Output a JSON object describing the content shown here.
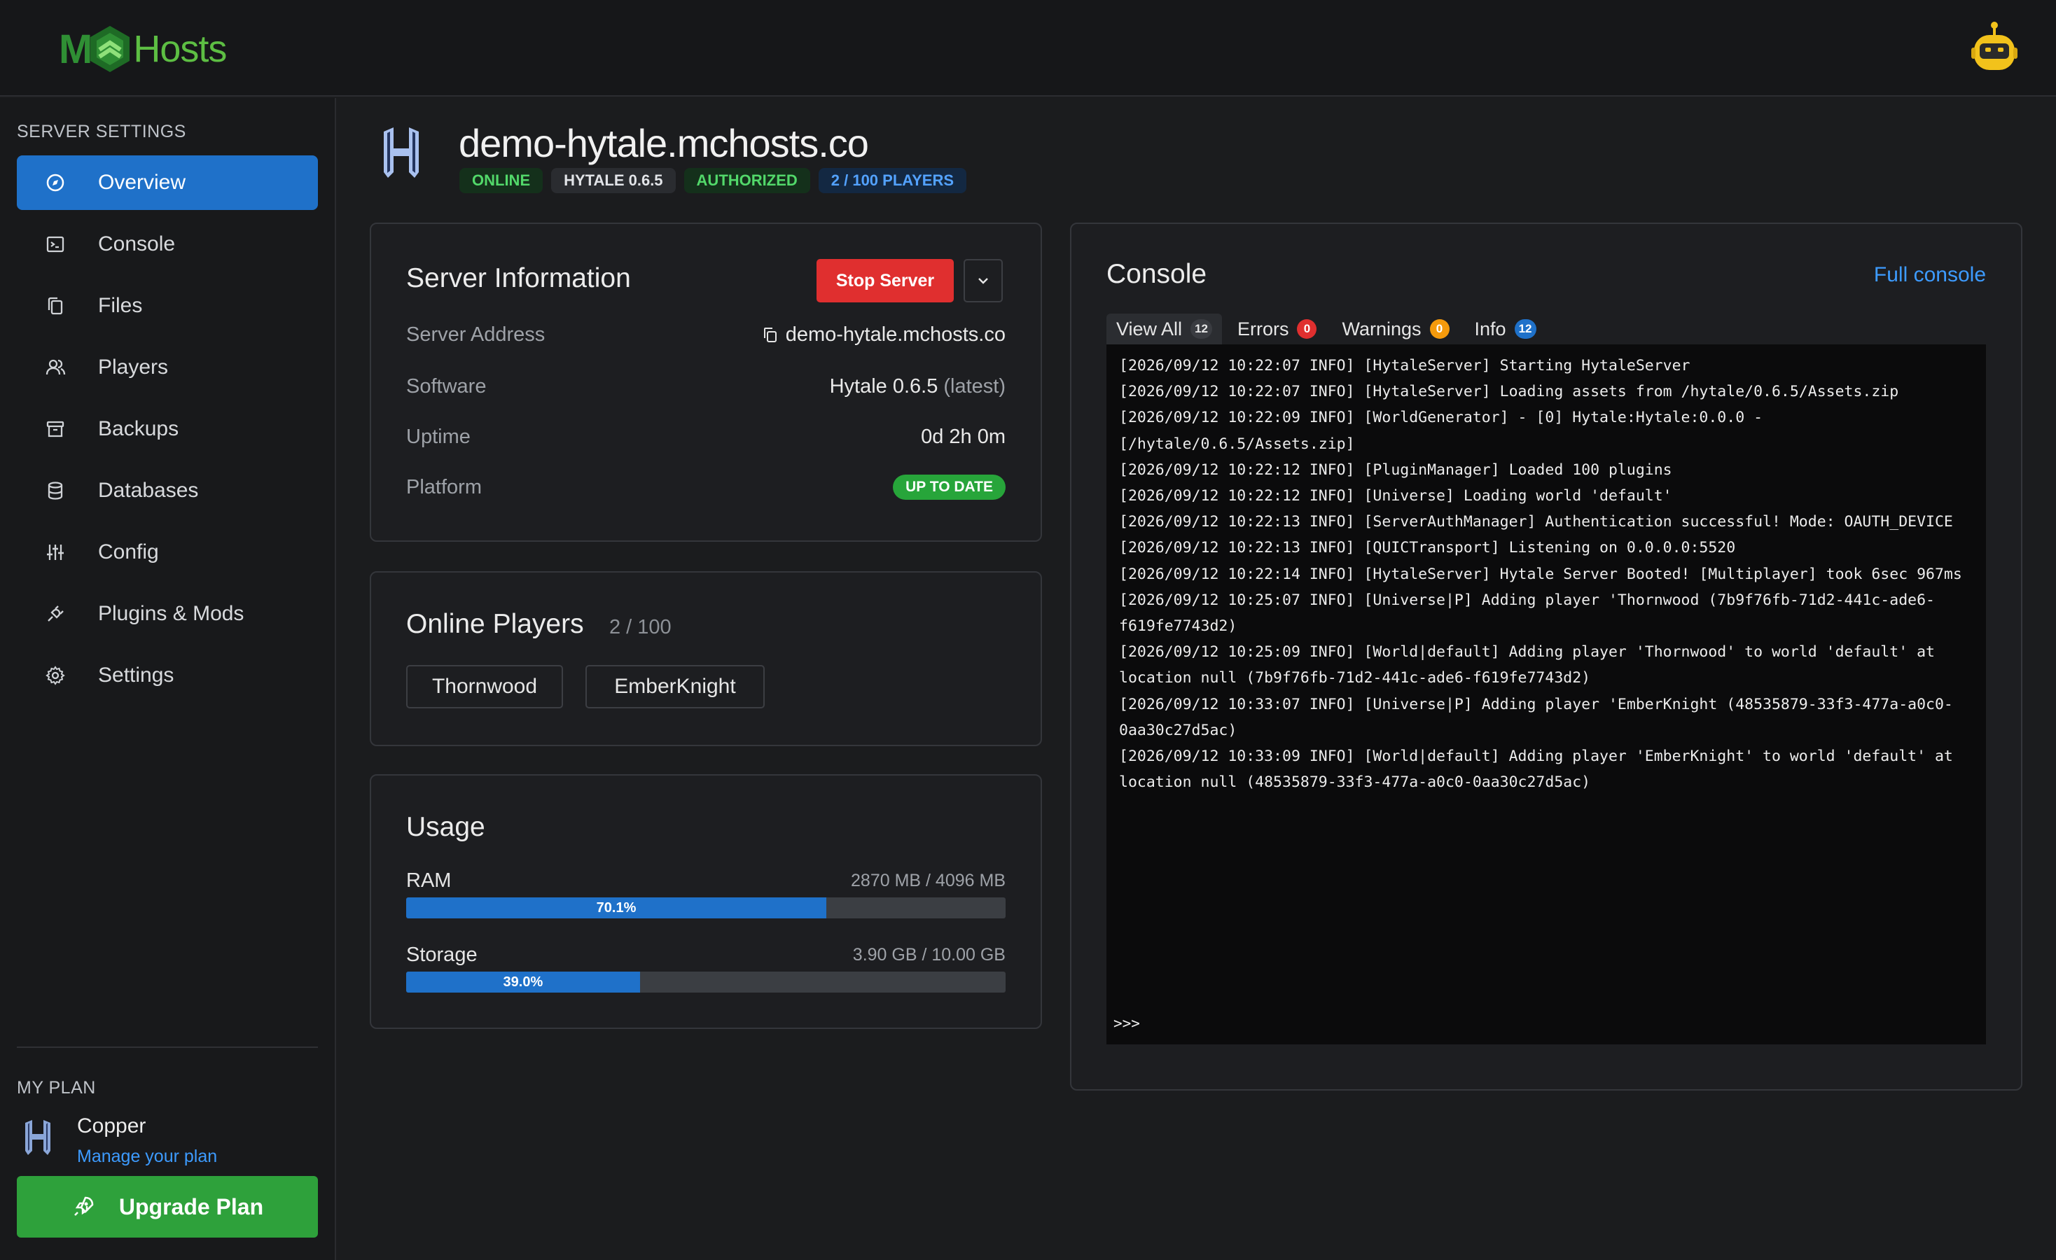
{
  "brand": {
    "logo_m": "M",
    "logo_hosts": "Hosts"
  },
  "sidebar": {
    "section_label": "SERVER SETTINGS",
    "items": [
      {
        "label": "Overview",
        "icon": "compass-icon"
      },
      {
        "label": "Console",
        "icon": "terminal-icon"
      },
      {
        "label": "Files",
        "icon": "files-icon"
      },
      {
        "label": "Players",
        "icon": "users-icon"
      },
      {
        "label": "Backups",
        "icon": "archive-icon"
      },
      {
        "label": "Databases",
        "icon": "database-icon"
      },
      {
        "label": "Config",
        "icon": "sliders-icon"
      },
      {
        "label": "Plugins & Mods",
        "icon": "plug-icon"
      },
      {
        "label": "Settings",
        "icon": "gear-icon"
      }
    ],
    "plan_section_label": "MY PLAN",
    "plan_name": "Copper",
    "plan_link": "Manage your plan",
    "upgrade_label": "Upgrade Plan"
  },
  "header": {
    "title": "demo-hytale.mchosts.co",
    "badges": [
      "ONLINE",
      "HYTALE 0.6.5",
      "AUTHORIZED",
      "2 / 100 PLAYERS"
    ]
  },
  "server_info": {
    "title": "Server Information",
    "stop_label": "Stop Server",
    "rows": [
      {
        "key": "Server Address",
        "value": "demo-hytale.mchosts.co"
      },
      {
        "key": "Software",
        "value": "Hytale 0.6.5",
        "note": "(latest)"
      },
      {
        "key": "Uptime",
        "value": "0d 2h 0m"
      },
      {
        "key": "Platform",
        "value": "UP TO DATE"
      }
    ]
  },
  "online_players": {
    "title": "Online Players",
    "count": "2 / 100",
    "players": [
      "Thornwood",
      "EmberKnight"
    ]
  },
  "usage": {
    "title": "Usage",
    "ram": {
      "label": "RAM",
      "value": "2870 MB / 4096 MB",
      "percent": 70.1,
      "percent_label": "70.1%"
    },
    "storage": {
      "label": "Storage",
      "value": "3.90 GB / 10.00 GB",
      "percent": 39.0,
      "percent_label": "39.0%"
    }
  },
  "console": {
    "title": "Console",
    "full_link": "Full console",
    "tabs": [
      {
        "label": "View All",
        "count": "12"
      },
      {
        "label": "Errors",
        "count": "0"
      },
      {
        "label": "Warnings",
        "count": "0"
      },
      {
        "label": "Info",
        "count": "12"
      }
    ],
    "lines": [
      "[2026/09/12 10:22:07 INFO] [HytaleServer] Starting HytaleServer",
      "[2026/09/12 10:22:07 INFO] [HytaleServer] Loading assets from /hytale/0.6.5/Assets.zip",
      "[2026/09/12 10:22:09 INFO] [WorldGenerator] - [0] Hytale:Hytale:0.0.0 - [/hytale/0.6.5/Assets.zip]",
      "[2026/09/12 10:22:12 INFO] [PluginManager] Loaded 100 plugins",
      "[2026/09/12 10:22:12 INFO] [Universe] Loading world 'default'",
      "[2026/09/12 10:22:13 INFO] [ServerAuthManager] Authentication successful! Mode: OAUTH_DEVICE",
      "[2026/09/12 10:22:13 INFO] [QUICTransport] Listening on 0.0.0.0:5520",
      "[2026/09/12 10:22:14 INFO] [HytaleServer] Hytale Server Booted! [Multiplayer] took 6sec 967ms",
      "[2026/09/12 10:25:07 INFO] [Universe|P] Adding player 'Thornwood (7b9f76fb-71d2-441c-ade6-f619fe7743d2)",
      "[2026/09/12 10:25:09 INFO] [World|default] Adding player 'Thornwood' to world 'default' at location null (7b9f76fb-71d2-441c-ade6-f619fe7743d2)",
      "[2026/09/12 10:33:07 INFO] [Universe|P] Adding player 'EmberKnight (48535879-33f3-477a-a0c0-0aa30c27d5ac)",
      "[2026/09/12 10:33:09 INFO] [World|default] Adding player 'EmberKnight' to world 'default' at location null (48535879-33f3-477a-a0c0-0aa30c27d5ac)"
    ],
    "prompt": ">>>"
  },
  "colors": {
    "accent": "#1f71c9",
    "danger": "#e02f2f",
    "success": "#2ea13b",
    "link": "#3d9bff"
  }
}
